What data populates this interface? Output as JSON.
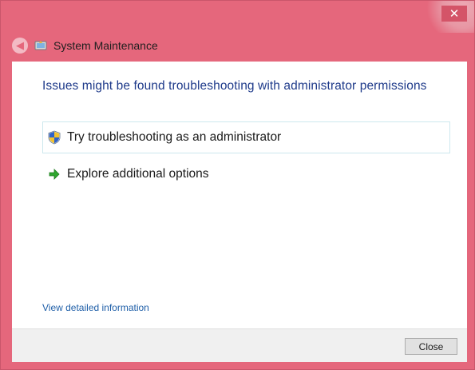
{
  "window": {
    "title": "System Maintenance",
    "close_glyph": "✕",
    "back_glyph": "◀"
  },
  "content": {
    "heading": "Issues might be found troubleshooting with administrator permissions",
    "options": [
      {
        "label": "Try troubleshooting as an administrator",
        "icon": "uac-shield-icon"
      },
      {
        "label": "Explore additional options",
        "icon": "green-arrow-icon"
      }
    ],
    "details_link": "View detailed information"
  },
  "footer": {
    "close_label": "Close"
  },
  "colors": {
    "frame": "#e5677c",
    "heading": "#1e3a8a",
    "link": "#1f5fa8"
  }
}
